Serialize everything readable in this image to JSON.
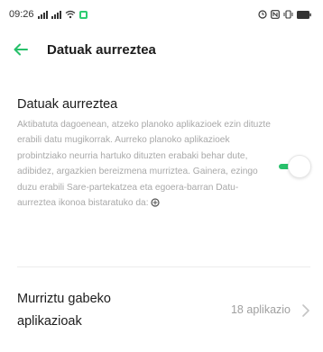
{
  "status_bar": {
    "time": "09:26",
    "sim1_label": "",
    "sim2_label": "",
    "icons": [
      "signal-icon",
      "signal-icon",
      "wifi-icon",
      "app-notification-icon",
      "alarm-icon",
      "nfc-icon",
      "vibrate-icon",
      "battery-icon"
    ],
    "accent": "#2ecc71"
  },
  "header": {
    "back_icon": "arrow-left-icon",
    "title": "Datuak aurreztea",
    "accent": "#27c06a"
  },
  "data_saver": {
    "title": "Datuak aurreztea",
    "description": "Aktibatuta dagoenean, atzeko planoko aplikazioek ezin dituzte erabili datu mugikorrak. Aurreko planoko aplikazioek probintziako neurria hartuko dituzten erabaki behar dute, adibidez, argazkien bereizmena murriztea. Gainera, ezingo duzu erabili Sare-partekatzea eta egoera-barran Datu-aurreztea ikonoa bistaratuko da:",
    "description_icon": "data-saver-icon",
    "toggle_on": true,
    "toggle_color": "#27c06a"
  },
  "unrestricted_apps": {
    "label": "Murriztu gabeko aplikazioak",
    "value": "18 aplikazio",
    "chevron_icon": "chevron-right-icon"
  }
}
